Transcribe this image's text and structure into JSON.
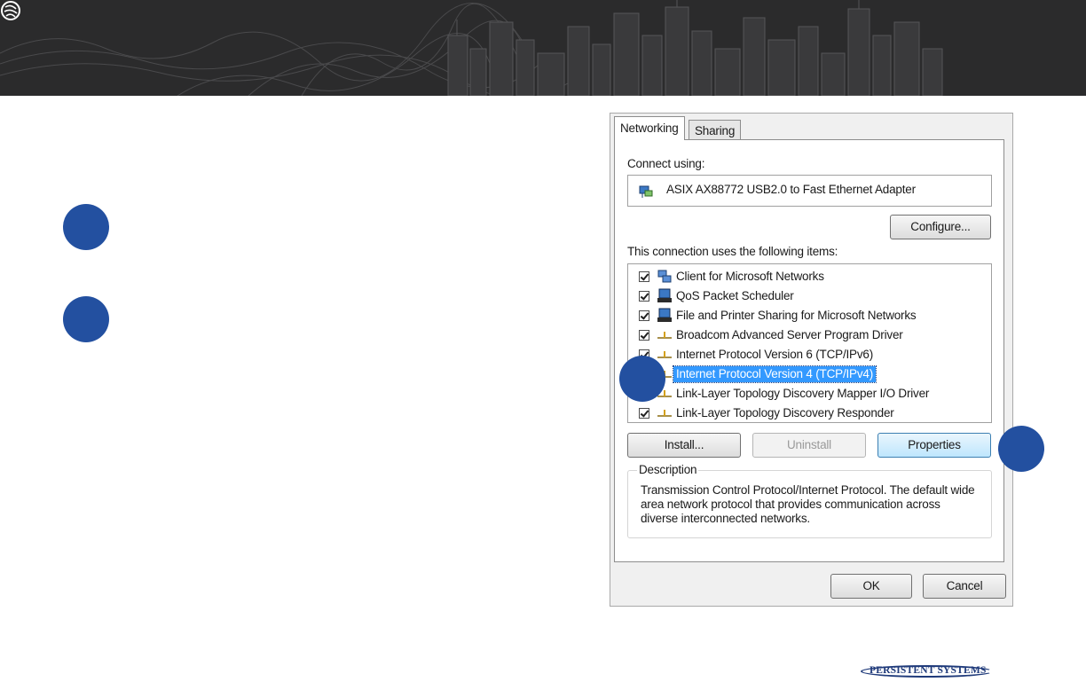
{
  "dialog": {
    "tabs": [
      {
        "label": "Networking",
        "active": true
      },
      {
        "label": "Sharing",
        "active": false
      }
    ],
    "connect_using_label": "Connect using:",
    "adapter_name": "ASIX AX88772 USB2.0 to Fast Ethernet Adapter",
    "configure_label": "Configure...",
    "items_label": "This connection uses the following items:",
    "items": [
      {
        "label": "Client for Microsoft Networks",
        "checked": true,
        "icon": "network-client-icon"
      },
      {
        "label": "QoS Packet Scheduler",
        "checked": true,
        "icon": "network-service-icon"
      },
      {
        "label": "File and Printer Sharing for Microsoft Networks",
        "checked": true,
        "icon": "network-service-icon"
      },
      {
        "label": "Broadcom Advanced Server Program Driver",
        "checked": true,
        "icon": "protocol-icon"
      },
      {
        "label": "Internet Protocol Version 6 (TCP/IPv6)",
        "checked": true,
        "icon": "protocol-icon"
      },
      {
        "label": "Internet Protocol Version 4 (TCP/IPv4)",
        "checked": true,
        "selected": true,
        "icon": "protocol-icon"
      },
      {
        "label": "Link-Layer Topology Discovery Mapper I/O Driver",
        "checked": true,
        "icon": "protocol-icon"
      },
      {
        "label": "Link-Layer Topology Discovery Responder",
        "checked": true,
        "icon": "protocol-icon"
      }
    ],
    "install_label": "Install...",
    "uninstall_label": "Uninstall",
    "properties_label": "Properties",
    "description_title": "Description",
    "description_text": "Transmission Control Protocol/Internet Protocol. The default wide area network protocol that provides communication across diverse interconnected networks.",
    "ok_label": "OK",
    "cancel_label": "Cancel"
  },
  "footer": {
    "brand": "PERSISTENT SYSTEMS"
  },
  "colors": {
    "banner": "#2b2b2c",
    "marker": "#2350a0",
    "selection": "#3399ff",
    "brand": "#1f3a7a"
  }
}
